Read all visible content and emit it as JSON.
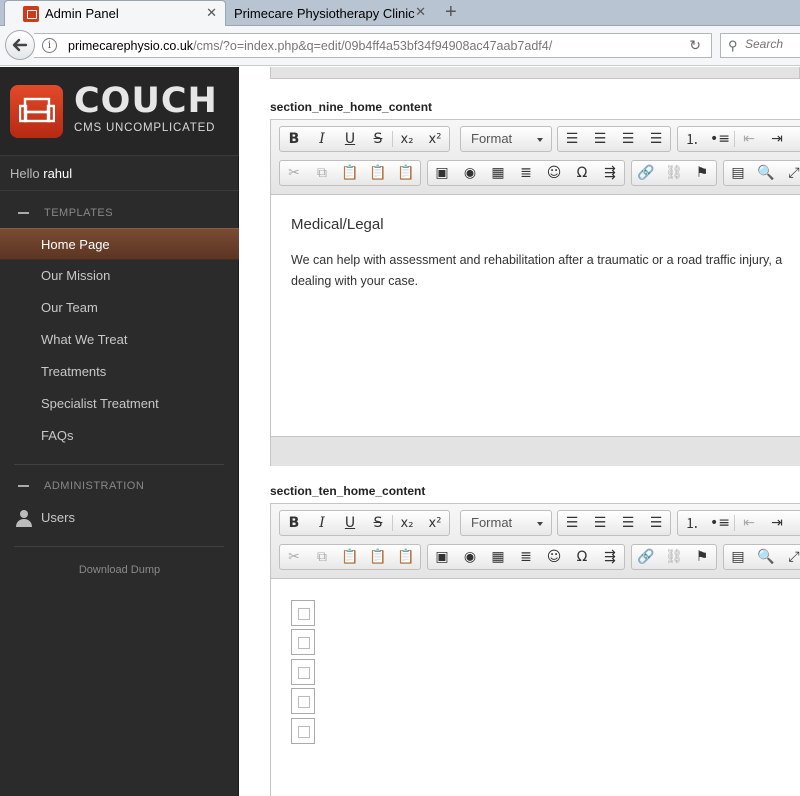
{
  "browser": {
    "tabs": [
      {
        "label": "Admin Panel",
        "active": true
      },
      {
        "label": "Primecare Physiotherapy Clinic",
        "active": false
      }
    ],
    "url_host": "primecarephysio.co.uk",
    "url_rest": "/cms/?o=index.php&q=edit/09b4ff4a53bf34f94908ac47aab7adf4/",
    "search_placeholder": "Search"
  },
  "sidebar": {
    "logo_title": "COUCH",
    "logo_subtitle": "CMS UNCOMPLICATED",
    "hello_prefix": "Hello",
    "username": "rahul",
    "templates_heading": "TEMPLATES",
    "templates": [
      {
        "label": "Home Page",
        "active": true
      },
      {
        "label": "Our Mission"
      },
      {
        "label": "Our Team"
      },
      {
        "label": "What We Treat"
      },
      {
        "label": "Treatments"
      },
      {
        "label": "Specialist Treatment"
      },
      {
        "label": "FAQs"
      }
    ],
    "admin_heading": "ADMINISTRATION",
    "users_label": "Users",
    "download_label": "Download Dump"
  },
  "main": {
    "field1_label": "section_nine_home_content",
    "field2_label": "section_ten_home_content",
    "format_label": "Format",
    "field1_heading": "Medical/Legal",
    "field1_text_line1": "We can help with assessment and rehabilitation after a traumatic or a road traffic injury, a",
    "field1_text_line2": "dealing with your case."
  }
}
